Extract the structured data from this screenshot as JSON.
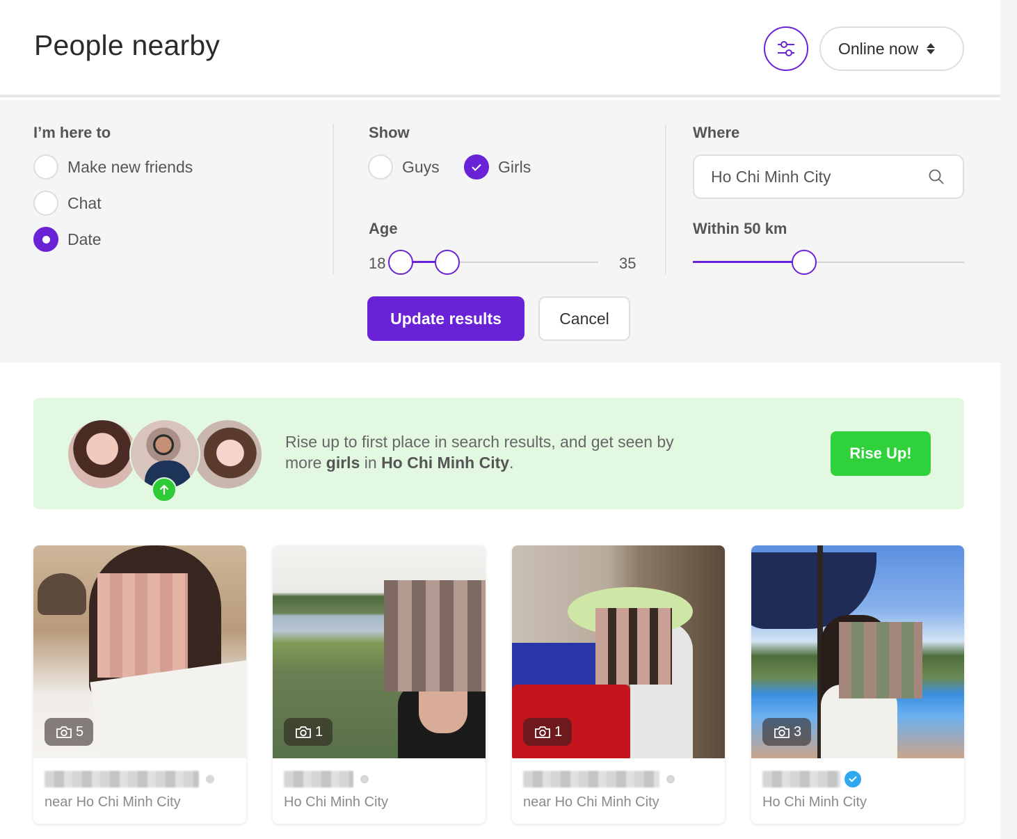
{
  "header": {
    "title": "People nearby",
    "filter_toggle_icon": "sliders-icon",
    "online_select": {
      "value": "Online now",
      "icon": "sort-arrows-icon"
    }
  },
  "filters": {
    "purpose": {
      "label": "I’m here to",
      "options": [
        {
          "label": "Make new friends",
          "selected": false
        },
        {
          "label": "Chat",
          "selected": false
        },
        {
          "label": "Date",
          "selected": true
        }
      ]
    },
    "show": {
      "label": "Show",
      "options": [
        {
          "label": "Guys",
          "checked": false
        },
        {
          "label": "Girls",
          "checked": true
        }
      ]
    },
    "age": {
      "label": "Age",
      "min_label": "18",
      "max_label": "35",
      "range_min": 18,
      "range_max": 35,
      "selected_low": 18,
      "selected_high": 22
    },
    "where": {
      "label": "Where",
      "value": "Ho Chi Minh City",
      "icon": "search-icon"
    },
    "distance": {
      "label": "Within 50 km",
      "fraction": 0.41
    },
    "update_label": "Update results",
    "cancel_label": "Cancel"
  },
  "promo": {
    "text_prefix": "Rise up to first place in search results, and get seen by more ",
    "text_bold1": "girls",
    "text_mid": " in ",
    "text_bold2": "Ho Chi Minh City",
    "text_suffix": ".",
    "button_label": "Rise Up!",
    "badge_icon": "arrow-up-icon"
  },
  "cards": [
    {
      "name": "[blurred], 2?",
      "photo_count": "5",
      "location": "near Ho Chi Minh City",
      "verified": false
    },
    {
      "name": "[blurred], 2?",
      "photo_count": "1",
      "location": "Ho Chi Minh City",
      "verified": false
    },
    {
      "name": "[blurred], 2?",
      "photo_count": "1",
      "location": "near Ho Chi Minh City",
      "verified": false
    },
    {
      "name": "[blurred], 2?",
      "photo_count": "3",
      "location": "Ho Chi Minh City",
      "verified": true
    }
  ],
  "colors": {
    "accent": "#6a22d6",
    "promo_bg": "#e2f8e1",
    "promo_button": "#2fd23a",
    "verified": "#2ea9f0"
  }
}
